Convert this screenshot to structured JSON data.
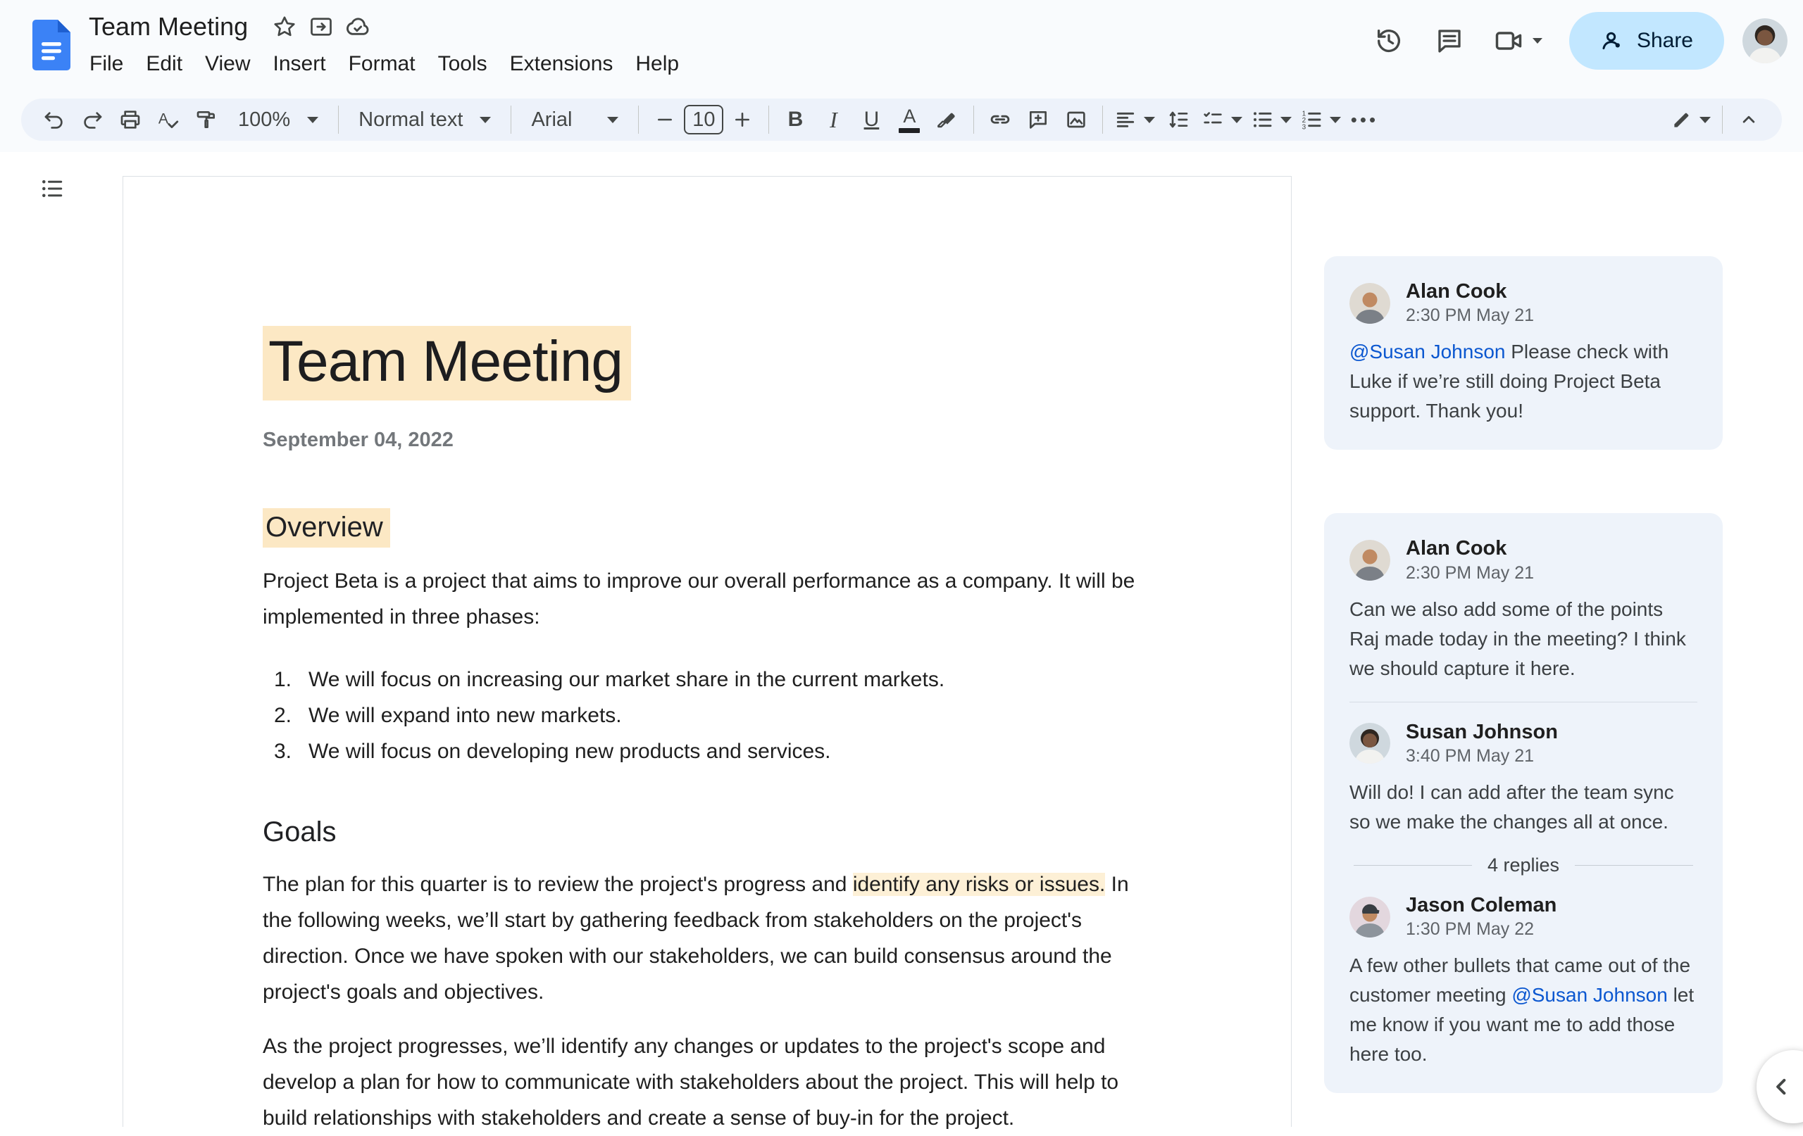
{
  "header": {
    "title": "Team Meeting",
    "menus": [
      "File",
      "Edit",
      "View",
      "Insert",
      "Format",
      "Tools",
      "Extensions",
      "Help"
    ],
    "share_label": "Share"
  },
  "toolbar": {
    "zoom": "100%",
    "style": "Normal text",
    "font": "Arial",
    "font_size": "10",
    "glyphs": {
      "bold": "B",
      "italic": "I",
      "underline": "U",
      "text_color": "A",
      "spell": "A",
      "more": "•••"
    }
  },
  "icons": [
    "docs-logo",
    "star-icon",
    "move-folder-icon",
    "cloud-check-icon",
    "history-icon",
    "comments-icon",
    "video-call-icon",
    "person-icon",
    "undo-icon",
    "redo-icon",
    "print-icon",
    "spellcheck-icon",
    "paint-format-icon",
    "link-icon",
    "add-comment-icon",
    "insert-image-icon",
    "align-icon",
    "line-spacing-icon",
    "checklist-icon",
    "bullet-list-icon",
    "numbered-list-icon",
    "pencil-icon",
    "collapse-icon",
    "outline-icon",
    "chevron-left-icon"
  ],
  "document": {
    "title": "Team Meeting",
    "date": "September 04, 2022",
    "overview_heading": "Overview",
    "overview_para": "Project Beta is a project that aims to improve our overall performance as a company. It will be implemented in three phases:",
    "list_numbers": [
      "1.",
      "2.",
      "3."
    ],
    "list": [
      "We will focus on increasing our market share in the current markets.",
      "We will expand into new markets.",
      "We will focus on developing new products and services."
    ],
    "goals_heading": "Goals",
    "goals_para1_pre": "The plan for this quarter is to review the project's progress and ",
    "goals_para1_highlight": "identify any risks or issues.",
    "goals_para1_post": " In the following weeks, we’ll start by gathering feedback from stakeholders on the project's direction. Once we have spoken with our stakeholders, we can build consensus around the project's goals and objectives.",
    "goals_para2": "As the project progresses, we’ll identify any changes or updates to the project's scope and develop a plan for how to communicate with stakeholders about the project. This will help to build relationships with stakeholders and create a sense of buy-in for the project."
  },
  "comments": {
    "card1": {
      "author": "Alan Cook",
      "time": "2:30 PM May 21",
      "mention": "@Susan Johnson",
      "text": " Please check with Luke if we’re still doing Project Beta support. Thank you!"
    },
    "card2": {
      "c1": {
        "author": "Alan Cook",
        "time": "2:30 PM May 21",
        "text": "Can we also add some of the points Raj made today in the meeting? I think we should capture it here."
      },
      "c2": {
        "author": "Susan Johnson",
        "time": "3:40 PM May 21",
        "text": "Will do! I can add after the team sync so we make the changes all at once."
      },
      "replies_label": "4 replies",
      "c3": {
        "author": "Jason Coleman",
        "time": "1:30 PM May 22",
        "pre": "A few other bullets that came out of the customer meeting ",
        "mention": "@Susan Johnson",
        "post": " let me know if you want me to add those here too."
      }
    }
  },
  "colors": {
    "accent_blue": "#0b57d0",
    "share_bg": "#c2e7ff",
    "toolbar_bg": "#edf2fa",
    "comment_card_bg": "#eef3fa",
    "title_highlight": "#fce8c4",
    "inline_highlight": "#fdf0d6"
  }
}
